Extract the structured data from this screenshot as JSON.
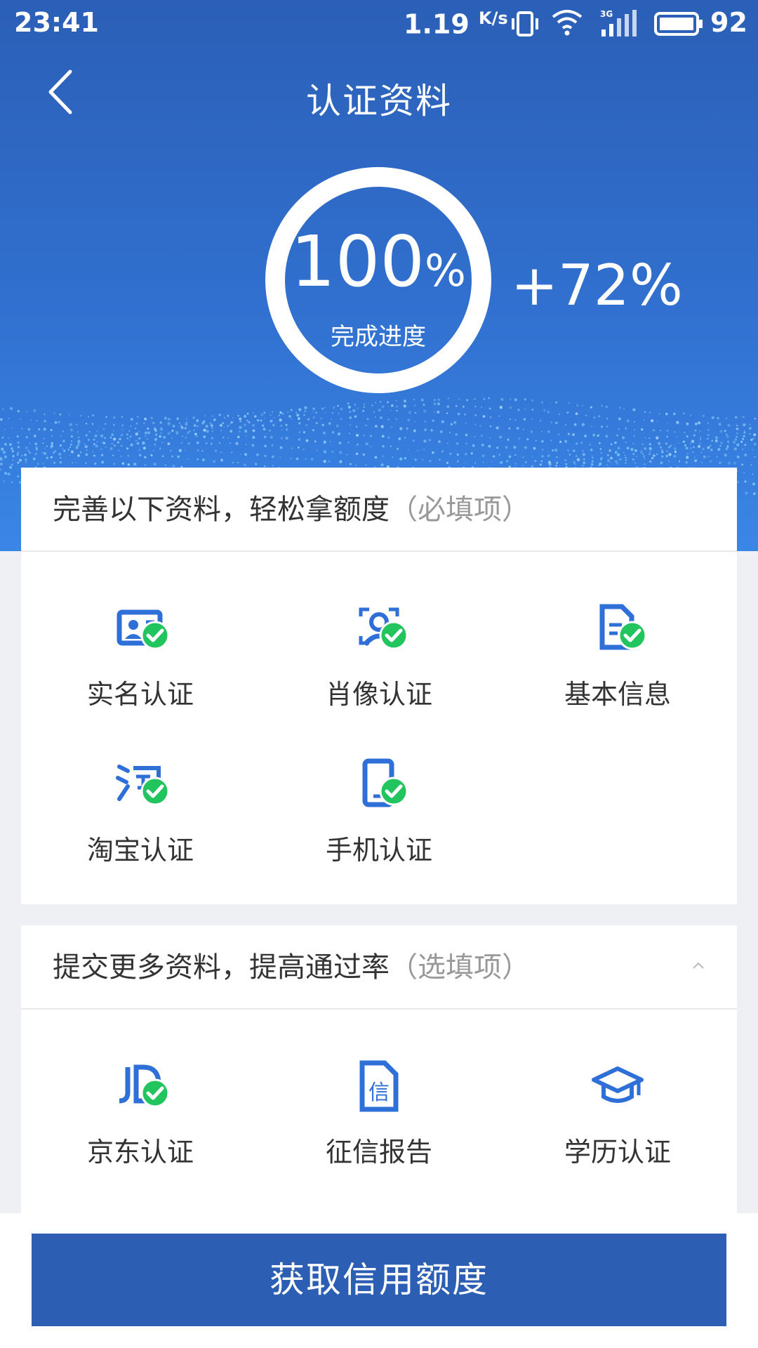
{
  "status_bar": {
    "time": "23:41",
    "speed": "1.19",
    "speed_unit": "K/s",
    "network": "3G",
    "battery": "92"
  },
  "header": {
    "title": "认证资料"
  },
  "progress": {
    "value": "100",
    "percent_sign": "%",
    "label": "完成进度",
    "delta": "+72%",
    "fraction": 1.0
  },
  "required_section": {
    "title": "完善以下资料，轻松拿额度",
    "hint": "（必填项）",
    "items": [
      {
        "label": "实名认证",
        "icon": "id-card-icon",
        "done": true
      },
      {
        "label": "肖像认证",
        "icon": "face-scan-icon",
        "done": true
      },
      {
        "label": "基本信息",
        "icon": "document-icon",
        "done": true
      },
      {
        "label": "淘宝认证",
        "icon": "taobao-icon",
        "done": true
      },
      {
        "label": "手机认证",
        "icon": "phone-icon",
        "done": true
      }
    ]
  },
  "optional_section": {
    "title": "提交更多资料，提高通过率",
    "hint": "（选填项）",
    "items": [
      {
        "label": "京东认证",
        "icon": "jd-icon",
        "done": true
      },
      {
        "label": "征信报告",
        "icon": "credit-report-icon",
        "done": false
      },
      {
        "label": "学历认证",
        "icon": "graduation-cap-icon",
        "done": false
      }
    ]
  },
  "cta": {
    "label": "获取信用额度"
  },
  "colors": {
    "primary": "#2c5fb3",
    "icon_blue": "#2f6fd8",
    "check_green": "#22c45e"
  }
}
